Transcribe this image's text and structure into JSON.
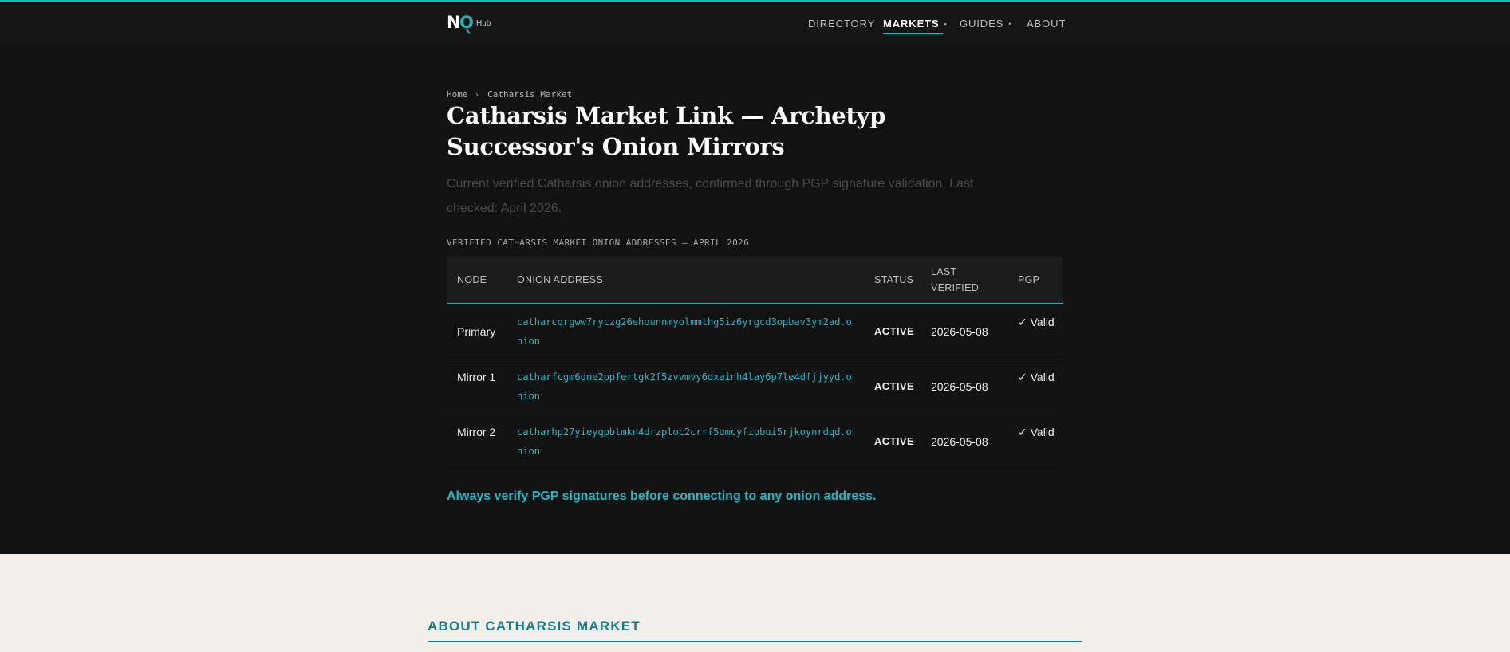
{
  "brand": {
    "logo_primary": "NO",
    "logo_suffix": "Hub",
    "accent_color": "#1fb3b3"
  },
  "nav": {
    "items": [
      {
        "label": "DIRECTORY",
        "dropdown": false,
        "active": false
      },
      {
        "label": "MARKETS",
        "dropdown": true,
        "active": true
      },
      {
        "label": "GUIDES",
        "dropdown": true,
        "active": false
      },
      {
        "label": "ABOUT",
        "dropdown": false,
        "active": false
      }
    ],
    "dropdown_indicator": "•"
  },
  "breadcrumb": {
    "home": "Home",
    "separator": "›",
    "current": "Catharsis Market"
  },
  "page": {
    "title": "Catharsis Market Link — Archetyp Successor's Onion Mirrors",
    "subtitle": "Current verified Catharsis onion addresses, confirmed through PGP signature validation. Last checked: April 2026."
  },
  "table": {
    "caption": "VERIFIED CATHARSIS MARKET ONION ADDRESSES — APRIL 2026",
    "headers": {
      "node": "NODE",
      "address": "ONION ADDRESS",
      "status": "STATUS",
      "last_verified": "LAST VERIFIED",
      "pgp": "PGP"
    },
    "rows": [
      {
        "node": "Primary",
        "address": "catharcqrgww7ryczg26ehounnmyolmmthg5iz6yrgcd3opbav3ym2ad.onion",
        "status": "ACTIVE",
        "last_verified": "2026-05-08",
        "pgp": "✓ Valid"
      },
      {
        "node": "Mirror 1",
        "address": "catharfcgm6dne2opfertgk2f5zvvmvy6dxainh4lay6p7le4dfjjyyd.onion",
        "status": "ACTIVE",
        "last_verified": "2026-05-08",
        "pgp": "✓ Valid"
      },
      {
        "node": "Mirror 2",
        "address": "catharhp27yieyqpbtmkn4drzploc2crrf5umcyfipbui5rjkoynrdqd.onion",
        "status": "ACTIVE",
        "last_verified": "2026-05-08",
        "pgp": "✓ Valid"
      }
    ]
  },
  "notice": {
    "warning": "Always verify PGP signatures before connecting to any onion address."
  },
  "about": {
    "heading": "ABOUT CATHARSIS MARKET"
  }
}
